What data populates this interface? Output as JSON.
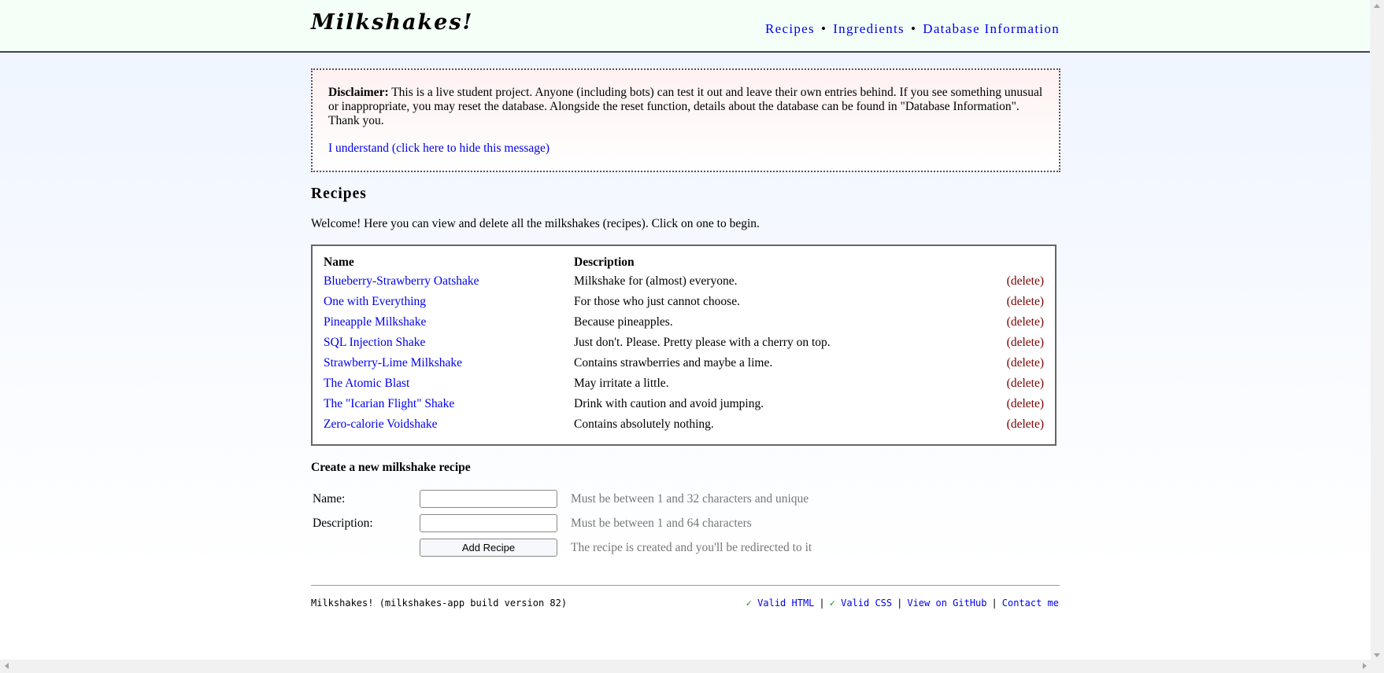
{
  "app": {
    "logo": "Milkshakes!"
  },
  "nav": {
    "items": [
      "Recipes",
      "Ingredients",
      "Database Information"
    ],
    "separator": "•"
  },
  "disclaimer": {
    "label": "Disclaimer:",
    "text": "This is a live student project. Anyone (including bots) can test it out and leave their own entries behind. If you see something unusual or inappropriate, you may reset the database. Alongside the reset function, details about the database can be found in \"Database Information\". Thank you.",
    "dismiss_link": "I understand (click here to hide this message)"
  },
  "recipes": {
    "heading": "Recipes",
    "welcome": "Welcome! Here you can view and delete all the milkshakes (recipes). Click on one to begin.",
    "columns": {
      "name": "Name",
      "description": "Description"
    },
    "delete_label": "(delete)",
    "rows": [
      {
        "name": "Blueberry-Strawberry Oatshake",
        "description": "Milkshake for (almost) everyone."
      },
      {
        "name": "One with Everything",
        "description": "For those who just cannot choose."
      },
      {
        "name": "Pineapple Milkshake",
        "description": "Because pineapples."
      },
      {
        "name": "SQL Injection Shake",
        "description": "Just don't. Please. Pretty please with a cherry on top."
      },
      {
        "name": "Strawberry-Lime Milkshake",
        "description": "Contains strawberries and maybe a lime."
      },
      {
        "name": "The Atomic Blast",
        "description": "May irritate a little."
      },
      {
        "name": "The \"Icarian Flight\" Shake",
        "description": "Drink with caution and avoid jumping."
      },
      {
        "name": "Zero-calorie Voidshake",
        "description": "Contains absolutely nothing."
      }
    ]
  },
  "form": {
    "title": "Create a new milkshake recipe",
    "name_label": "Name:",
    "name_value": "",
    "name_hint": "Must be between 1 and 32 characters and unique",
    "description_label": "Description:",
    "description_value": "",
    "description_hint": "Must be between 1 and 64 characters",
    "submit_label": "Add Recipe",
    "submit_hint": "The recipe is created and you'll be redirected to it"
  },
  "footer": {
    "left": "Milkshakes! (milkshakes-app build version 82)",
    "check_mark": "✓",
    "links": [
      "Valid HTML",
      "Valid CSS",
      "View on GitHub",
      "Contact me"
    ],
    "separator": "|"
  },
  "colors": {
    "link": "#0000ee",
    "delete": "#7a0000",
    "hint": "#777777",
    "header_bg": "#f3fff7"
  }
}
